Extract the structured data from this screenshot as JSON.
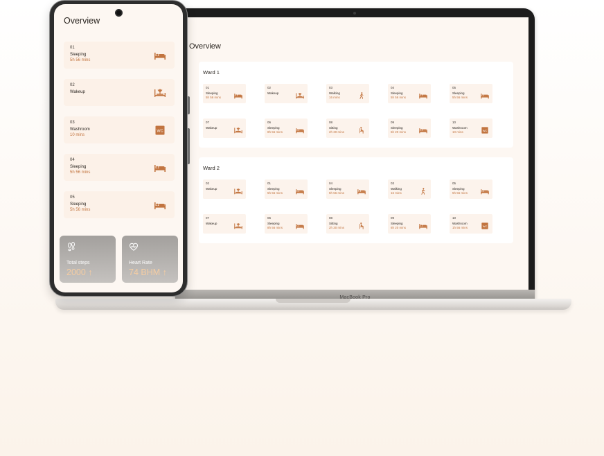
{
  "laptop": {
    "model_label": "MacBook Pro",
    "title": "Overview",
    "wards": [
      {
        "title": "Ward 1",
        "rooms": [
          {
            "num": "01",
            "status": "Sleeping",
            "duration": "5h 56 mins",
            "icon": "bed-icon"
          },
          {
            "num": "02",
            "status": "Wakeup",
            "duration": "",
            "icon": "wakeup-icon"
          },
          {
            "num": "03",
            "status": "Walking",
            "duration": "16 mins",
            "icon": "walking-icon"
          },
          {
            "num": "04",
            "status": "Sleeping",
            "duration": "5h 56 mins",
            "icon": "bed-icon"
          },
          {
            "num": "05",
            "status": "Sleeping",
            "duration": "5h 56 mins",
            "icon": "bed-icon"
          },
          {
            "num": "07",
            "status": "Wakeup",
            "duration": "",
            "icon": "wakeup-icon"
          },
          {
            "num": "06",
            "status": "Sleeping",
            "duration": "8h 56 mins",
            "icon": "bed-icon"
          },
          {
            "num": "08",
            "status": "Sitting",
            "duration": "2h 30 mins",
            "icon": "sitting-icon"
          },
          {
            "num": "09",
            "status": "Sleeping",
            "duration": "6h 20 mins",
            "icon": "bed-icon"
          },
          {
            "num": "10",
            "status": "Washroom",
            "duration": "10 mins",
            "icon": "wc-icon"
          }
        ]
      },
      {
        "title": "Ward 2",
        "rooms": [
          {
            "num": "02",
            "status": "Wakeup",
            "duration": "",
            "icon": "wakeup-icon"
          },
          {
            "num": "01",
            "status": "Sleeping",
            "duration": "5h 56 mins",
            "icon": "bed-icon"
          },
          {
            "num": "04",
            "status": "Sleeping",
            "duration": "5h 56 mins",
            "icon": "bed-icon"
          },
          {
            "num": "03",
            "status": "Walking",
            "duration": "16 mins",
            "icon": "walking-icon"
          },
          {
            "num": "05",
            "status": "Sleeping",
            "duration": "5h 56 mins",
            "icon": "bed-icon"
          },
          {
            "num": "07",
            "status": "Wakeup",
            "duration": "",
            "icon": "wakeup-icon"
          },
          {
            "num": "06",
            "status": "Sleeping",
            "duration": "8h 56 mins",
            "icon": "bed-icon"
          },
          {
            "num": "08",
            "status": "Sitting",
            "duration": "2h 30 mins",
            "icon": "sitting-icon"
          },
          {
            "num": "09",
            "status": "Sleeping",
            "duration": "6h 20 mins",
            "icon": "bed-icon"
          },
          {
            "num": "10",
            "status": "Washroom",
            "duration": "1h 56 mins",
            "icon": "wc-icon"
          }
        ]
      }
    ]
  },
  "phone": {
    "title": "Overview",
    "rooms": [
      {
        "num": "01",
        "status": "Sleeping",
        "duration": "5h 56 mins",
        "icon": "bed-icon"
      },
      {
        "num": "02",
        "status": "Wakeup",
        "duration": "",
        "icon": "wakeup-icon"
      },
      {
        "num": "03",
        "status": "Washroom",
        "duration": "10 mins",
        "icon": "wc-icon"
      },
      {
        "num": "04",
        "status": "Sleeping",
        "duration": "5h 56 mins",
        "icon": "bed-icon"
      },
      {
        "num": "05",
        "status": "Sleeping",
        "duration": "5h 56 mins",
        "icon": "bed-icon"
      }
    ],
    "stats": [
      {
        "label": "Total steps",
        "value": "2000 ↑",
        "icon": "footsteps-icon"
      },
      {
        "label": "Heart Rate",
        "value": "74 BHM ↑",
        "icon": "heart-rate-icon"
      }
    ]
  },
  "colors": {
    "accent": "#c2743f",
    "card_bg": "#fcf1e8",
    "screen_bg": "#fdf7f2"
  }
}
